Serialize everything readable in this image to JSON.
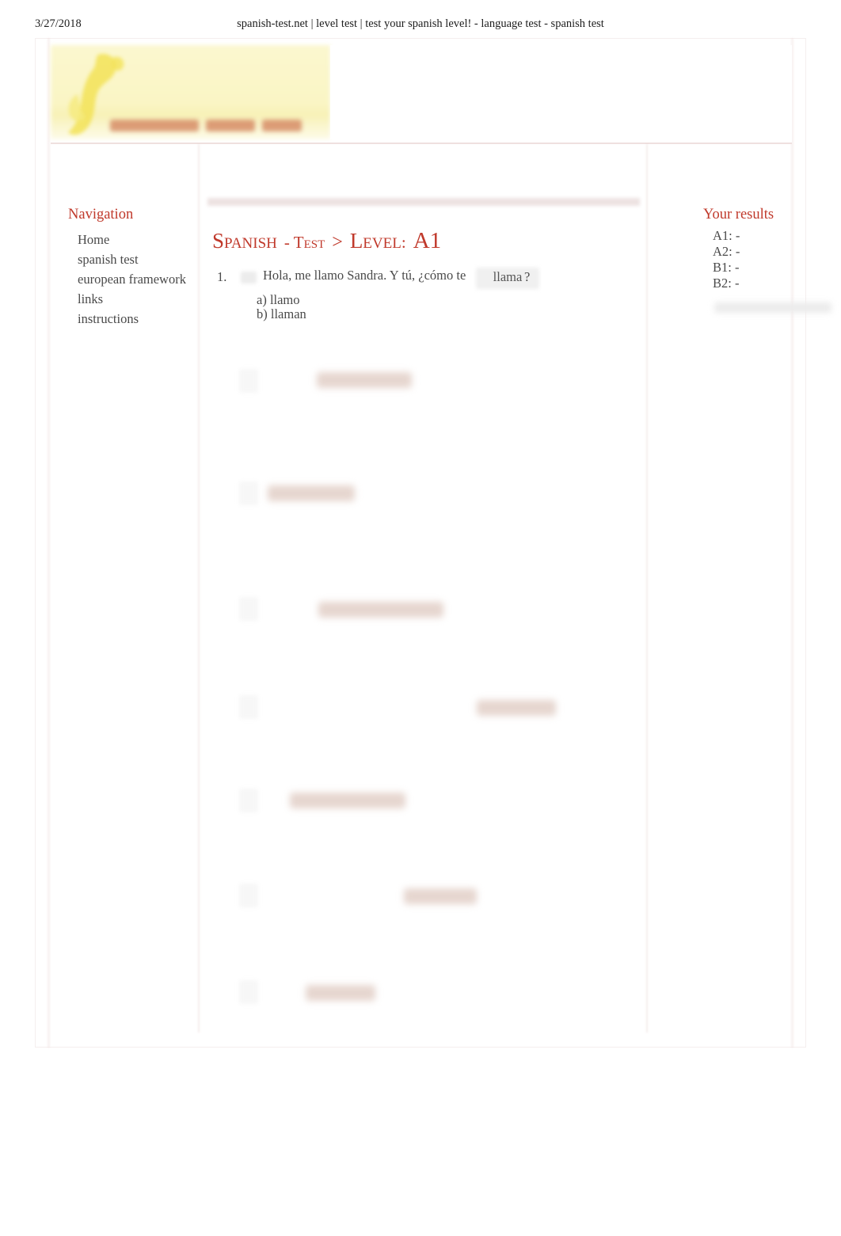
{
  "print_header": {
    "date": "3/27/2018",
    "title": "spanish-test.net | level test | test your spanish level! - language test - spanish test"
  },
  "logo": {
    "wordmark_alt": "spanish-test.net",
    "mark_alt": "rooster-logo-icon"
  },
  "sidebar": {
    "heading": "Navigation",
    "items": [
      {
        "label": "Home"
      },
      {
        "label": "spanish test"
      },
      {
        "label": "european framework"
      },
      {
        "label": "links"
      },
      {
        "label": "instructions"
      }
    ]
  },
  "main": {
    "title": {
      "part1": "Spanish",
      "part2": "- Test",
      "part3": ">",
      "part4": "Level",
      "part5": ":",
      "part6": "A1"
    },
    "questions": [
      {
        "number": "1.",
        "prompt_before": "Hola, me llamo Sandra. Y tú, ¿cómo te",
        "answer_value": "llama",
        "prompt_after": "?",
        "options": [
          "a) llamo",
          "b) llaman"
        ]
      }
    ]
  },
  "results": {
    "heading": "Your results",
    "items": [
      {
        "label": "A1: -"
      },
      {
        "label": "A2: -"
      },
      {
        "label": "B1: -"
      },
      {
        "label": "B2: -"
      }
    ]
  },
  "colors": {
    "accent": "#c0392b",
    "text": "#4a4a4a",
    "logo_band": "#faf5c4",
    "logo_word": "#d07a55"
  }
}
